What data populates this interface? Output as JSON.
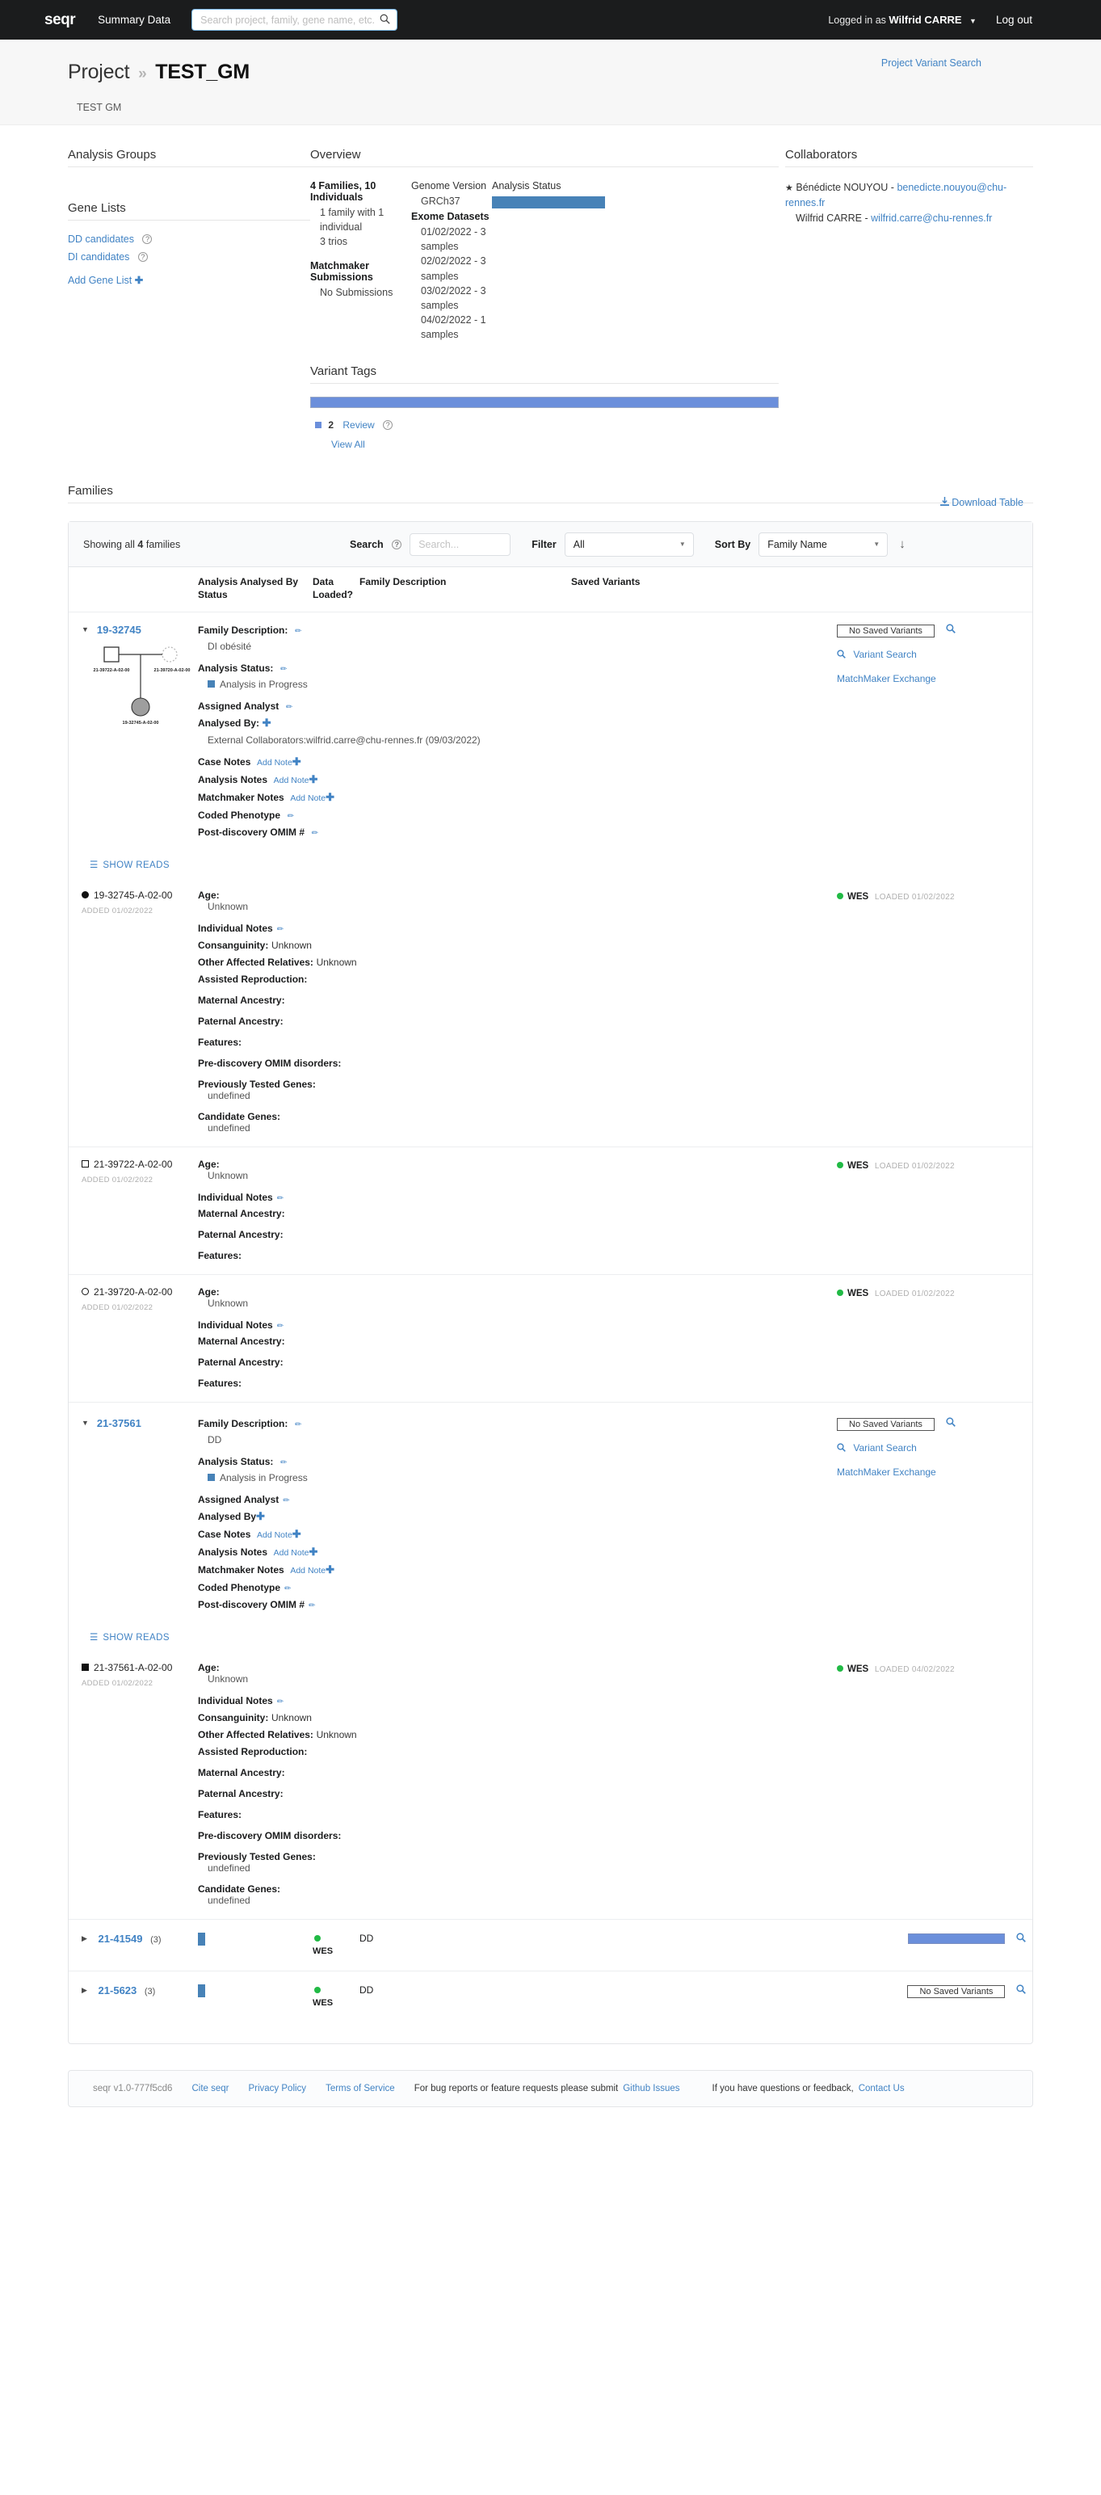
{
  "topnav": {
    "logo": "seqr",
    "summary_data": "Summary Data",
    "search_placeholder": "Search project, family, gene name, etc.",
    "search_value": "",
    "search_icon": "search-icon",
    "logged_in_prefix": "Logged in as",
    "user_name": "Wilfrid CARRE",
    "logout": "Log out"
  },
  "header": {
    "breadcrumb_root": "Project",
    "separator": "»",
    "project_name": "TEST_GM",
    "project_subtitle": "TEST GM",
    "project_variant_search": "Project Variant Search"
  },
  "analysis_groups": {
    "title": "Analysis Groups"
  },
  "gene_lists": {
    "title": "Gene Lists",
    "items": [
      {
        "label": "DD candidates"
      },
      {
        "label": "DI candidates"
      }
    ],
    "add_label": "Add Gene List"
  },
  "overview": {
    "title": "Overview",
    "families_heading": "4 Families, 10 Individuals",
    "families_details": "1 family with 1 individual\n3 trios",
    "matchmaker_heading": "Matchmaker Submissions",
    "matchmaker_value": "No Submissions",
    "genome_version_heading": "Genome Version",
    "genome_version_value": "GRCh37",
    "exome_heading": "Exome Datasets",
    "exome_values": "01/02/2022 - 3 samples\n02/02/2022 - 3 samples\n03/02/2022 - 3 samples\n04/02/2022 - 1 samples",
    "analysis_status_heading": "Analysis Status",
    "analysis_status_color": "#4782b7"
  },
  "collaborators": {
    "title": "Collaborators",
    "items": [
      {
        "starred": true,
        "name": "Bénédicte NOUYOU",
        "email": "benedicte.nouyou@chu-rennes.fr"
      },
      {
        "starred": false,
        "name": "Wilfrid CARRE",
        "email": "wilfrid.carre@chu-rennes.fr"
      }
    ]
  },
  "variant_tags": {
    "title": "Variant Tags",
    "bar_color": "#6b8fdb",
    "legend_count": "2",
    "legend_label": "Review",
    "view_all": "View All"
  },
  "families_section": {
    "title": "Families",
    "download_table": "Download Table",
    "showing_prefix": "Showing all",
    "showing_count": "4",
    "showing_suffix": "families",
    "search_label": "Search",
    "search_placeholder": "Search...",
    "search_value": "",
    "filter_label": "Filter",
    "filter_value": "All",
    "sort_label": "Sort By",
    "sort_value": "Family Name",
    "sort_direction_icon": "arrow-down-icon",
    "columns": {
      "analysis_status": "Analysis Status",
      "analysed_by": "Analysed By",
      "data_loaded": "Data Loaded?",
      "family_description": "Family Description",
      "saved_variants": "Saved Variants"
    }
  },
  "labels": {
    "family_description": "Family Description:",
    "analysis_status": "Analysis Status:",
    "assigned_analyst": "Assigned Analyst",
    "analysed_by": "Analysed By:",
    "analysed_by_plain": "Analysed By",
    "case_notes": "Case Notes",
    "analysis_notes": "Analysis Notes",
    "matchmaker_notes": "Matchmaker Notes",
    "coded_phenotype": "Coded Phenotype",
    "post_discovery": "Post-discovery OMIM #",
    "add_note": "Add Note",
    "show_reads": "SHOW READS",
    "no_saved_variants": "No Saved Variants",
    "variant_search": "Variant Search",
    "matchmaker_exchange": "MatchMaker Exchange",
    "age": "Age:",
    "individual_notes": "Individual Notes",
    "consanguinity": "Consanguinity:",
    "other_affected": "Other Affected Relatives:",
    "assisted_repro": "Assisted Reproduction:",
    "maternal": "Maternal Ancestry:",
    "paternal": "Paternal Ancestry:",
    "features": "Features:",
    "pre_discovery": "Pre-discovery OMIM disorders:",
    "prev_tested": "Previously Tested Genes:",
    "candidate_genes": "Candidate Genes:",
    "added": "ADDED",
    "loaded": "LOADED",
    "wes": "WES",
    "unknown": "Unknown",
    "undefined": "undefined"
  },
  "families": [
    {
      "name": "19-32745",
      "expanded": true,
      "description": "DI obésité",
      "analysis_status": "Analysis in Progress",
      "analysed_by_value": "External Collaborators:wilfrid.carre@chu-rennes.fr (09/03/2022)",
      "saved_variants": "No Saved Variants",
      "pedigree": {
        "father_id": "21-39722-A-02-00",
        "mother_id": "21-39720-A-02-00",
        "child_id": "19-32745-A-02-00"
      },
      "individuals": [
        {
          "id": "19-32745-A-02-00",
          "shape": "filled-circle",
          "added": "01/02/2022",
          "age": "Unknown",
          "consanguinity": "Unknown",
          "other_affected": "Unknown",
          "assisted_repro": "",
          "maternal": "",
          "paternal": "",
          "features": "",
          "pre_discovery": "",
          "prev_tested": "undefined",
          "candidate_genes": "undefined",
          "data_type": "WES",
          "loaded_date": "01/02/2022",
          "full": true
        },
        {
          "id": "21-39722-A-02-00",
          "shape": "square",
          "added": "01/02/2022",
          "age": "Unknown",
          "maternal": "",
          "paternal": "",
          "features": "",
          "data_type": "WES",
          "loaded_date": "01/02/2022",
          "full": false
        },
        {
          "id": "21-39720-A-02-00",
          "shape": "circle",
          "added": "01/02/2022",
          "age": "Unknown",
          "maternal": "",
          "paternal": "",
          "features": "",
          "data_type": "WES",
          "loaded_date": "01/02/2022",
          "full": false
        }
      ]
    },
    {
      "name": "21-37561",
      "expanded": true,
      "description": "DD",
      "analysis_status": "Analysis in Progress",
      "analysed_by_value": "",
      "saved_variants": "No Saved Variants",
      "individuals": [
        {
          "id": "21-37561-A-02-00",
          "shape": "filled-square",
          "added": "01/02/2022",
          "age": "Unknown",
          "consanguinity": "Unknown",
          "other_affected": "Unknown",
          "assisted_repro": "",
          "maternal": "",
          "paternal": "",
          "features": "",
          "pre_discovery": "",
          "prev_tested": "undefined",
          "candidate_genes": "undefined",
          "data_type": "WES",
          "loaded_date": "04/02/2022",
          "full": true
        }
      ]
    }
  ],
  "collapsed_families": [
    {
      "name": "21-41549",
      "count": "(3)",
      "data_type": "WES",
      "description": "DD",
      "saved_variants_type": "bar",
      "saved_variants": ""
    },
    {
      "name": "21-5623",
      "count": "(3)",
      "data_type": "WES",
      "description": "DD",
      "saved_variants_type": "none",
      "saved_variants": "No Saved Variants"
    }
  ],
  "footer": {
    "version": "seqr v1.0-777f5cd6",
    "cite": "Cite seqr",
    "privacy": "Privacy Policy",
    "terms": "Terms of Service",
    "bug_text": "For bug reports or feature requests please submit",
    "github": "Github Issues",
    "feedback_text": "If you have questions or feedback,",
    "contact": "Contact Us"
  }
}
